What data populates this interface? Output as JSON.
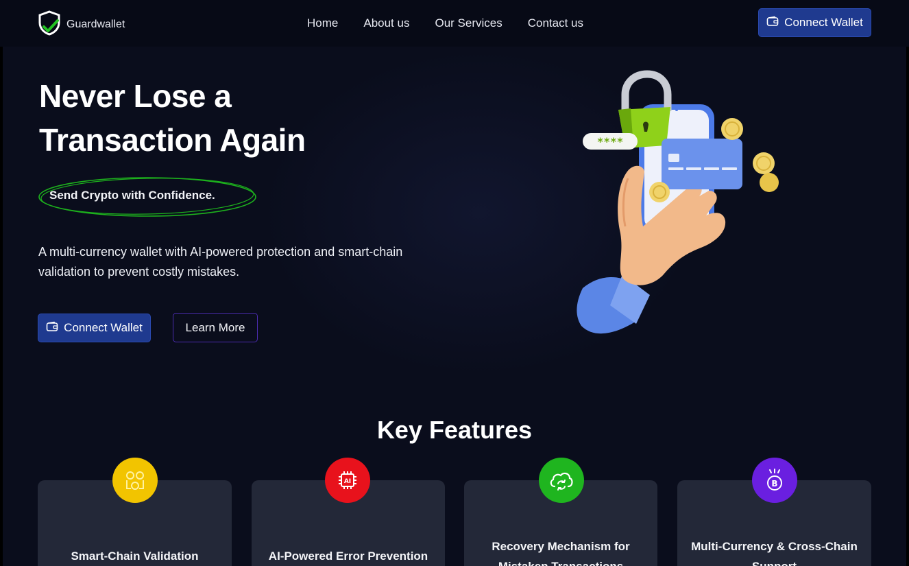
{
  "brand": {
    "name": "Guardwallet"
  },
  "nav": {
    "links": [
      "Home",
      "About us",
      "Our Services",
      "Contact us"
    ],
    "connect_label": "Connect Wallet"
  },
  "hero": {
    "title_line1": "Never Lose a",
    "title_line2": "Transaction Again",
    "tagline": "Send Crypto with Confidence.",
    "description": "A multi-currency wallet with AI-powered protection and smart-chain validation to prevent costly mistakes.",
    "connect_label": "Connect Wallet",
    "learn_more_label": "Learn More",
    "password_mask": "****"
  },
  "features": {
    "heading": "Key Features",
    "cards": [
      {
        "title": "Smart-Chain Validation",
        "icon": "blocks-icon",
        "color": "#f2c400"
      },
      {
        "title": "AI-Powered Error Prevention",
        "icon": "ai-chip-icon",
        "color": "#e8121c"
      },
      {
        "title": "Recovery Mechanism for Mistaken Transactions",
        "icon": "cloud-sync-icon",
        "color": "#1fb51f"
      },
      {
        "title": "Multi-Currency & Cross-Chain Support",
        "icon": "bitcoin-icon",
        "color": "#6a1fe0"
      }
    ]
  },
  "colors": {
    "background": "#0a0d1c",
    "primary_button": "#1f3a8f",
    "learn_more_border": "#4b2cb0",
    "tagline_ring": "#1db11d",
    "card_bg": "#232838"
  }
}
